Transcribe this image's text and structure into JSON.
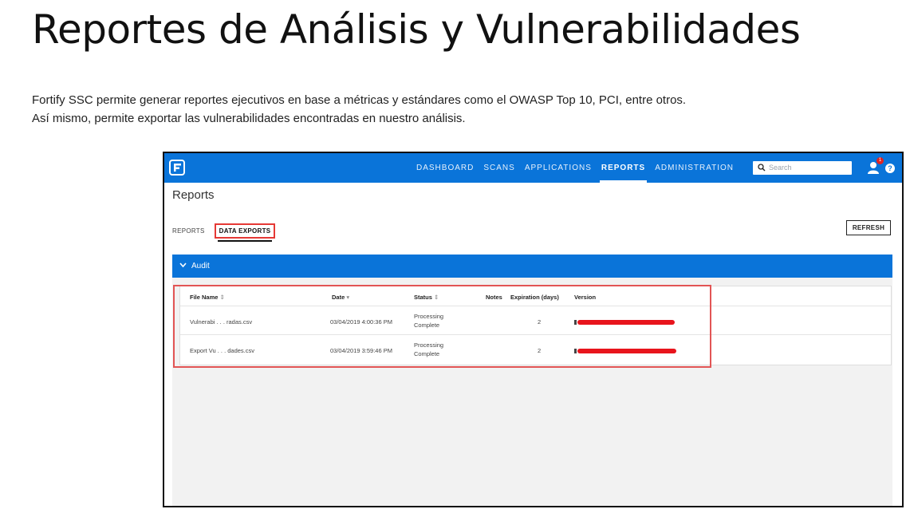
{
  "slide": {
    "title": "Reportes de Análisis y Vulnerabilidades",
    "paragraph_line1": "Fortify SSC permite generar reportes ejecutivos en base a métricas y estándares como el OWASP Top 10, PCI, entre otros.",
    "paragraph_line2": "Así mismo, permite exportar las vulnerabilidades encontradas en nuestro análisis."
  },
  "app": {
    "nav": [
      "DASHBOARD",
      "SCANS",
      "APPLICATIONS",
      "REPORTS",
      "ADMINISTRATION"
    ],
    "active_nav": "REPORTS",
    "search_placeholder": "Search",
    "notification_count": "1",
    "help_glyph": "?",
    "page_title": "Reports",
    "subtabs": [
      "REPORTS",
      "DATA EXPORTS"
    ],
    "active_subtab": "DATA EXPORTS",
    "refresh_label": "REFRESH",
    "section_label": "Audit",
    "colors": {
      "brand_blue": "#0a74d9",
      "highlight_red": "#e25555",
      "redaction_red": "#e8141c"
    },
    "icons": [
      "fortify-logo-icon",
      "search-icon",
      "user-icon",
      "help-icon",
      "chevron-down-icon",
      "sort-icon"
    ]
  },
  "table": {
    "headers": {
      "file_name": "File Name",
      "file_name_sort": "⇕",
      "date": "Date",
      "date_sort": "▾",
      "status": "Status",
      "status_sort": "⇕",
      "notes": "Notes",
      "expiration": "Expiration (days)",
      "version": "Version"
    },
    "rows": [
      {
        "file_name": "Vulnerabi . . . radas.csv",
        "date": "03/04/2019 4:00:36 PM",
        "status_line1": "Processing",
        "status_line2": "Complete",
        "notes": "",
        "expiration": "2"
      },
      {
        "file_name": "Export Vu . . . dades.csv",
        "date": "03/04/2019 3:59:46 PM",
        "status_line1": "Processing",
        "status_line2": "Complete",
        "notes": "",
        "expiration": "2"
      }
    ]
  }
}
